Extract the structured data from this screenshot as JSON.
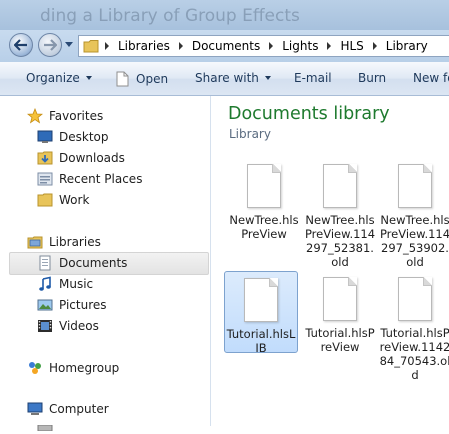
{
  "window": {
    "title_fragment": "ding a Library of Group Effects"
  },
  "address_bar": {
    "breadcrumbs": [
      "Libraries",
      "Documents",
      "Lights",
      "HLS",
      "Library"
    ]
  },
  "toolbar": {
    "organize": "Organize",
    "open": "Open",
    "share_with": "Share with",
    "email": "E-mail",
    "burn": "Burn",
    "new_folder_partial": "New fo"
  },
  "nav": {
    "favorites": "Favorites",
    "desktop": "Desktop",
    "downloads": "Downloads",
    "recent_places": "Recent Places",
    "work": "Work",
    "libraries": "Libraries",
    "documents": "Documents",
    "music": "Music",
    "pictures": "Pictures",
    "videos": "Videos",
    "homegroup": "Homegroup",
    "computer": "Computer"
  },
  "content": {
    "title": "Documents library",
    "subtitle": "Library",
    "files": [
      {
        "name": "NewTree.hlsPreView",
        "selected": false
      },
      {
        "name": "NewTree.hlsPreView.114297_52381.old",
        "selected": false
      },
      {
        "name": "NewTree.hlsPreView.114297_53902.old",
        "selected": false
      },
      {
        "name": "Tutorial.hlsLIB",
        "selected": true
      },
      {
        "name": "Tutorial.hlsPreView",
        "selected": false
      },
      {
        "name": "Tutorial.hlsPreView.114284_70543.old",
        "selected": false
      }
    ]
  },
  "colors": {
    "library_title": "#1e7a2e",
    "selection": "#c1dcfc",
    "toolbar_text": "#1e395b"
  }
}
